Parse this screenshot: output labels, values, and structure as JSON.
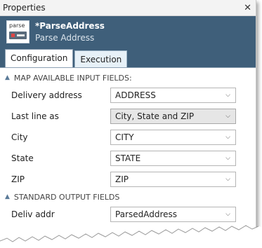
{
  "window": {
    "title": "Properties"
  },
  "header": {
    "icon_label": "parse",
    "title": "*ParseAddress",
    "subtitle": "Parse Address"
  },
  "tabs": [
    {
      "label": "Configuration",
      "active": true
    },
    {
      "label": "Execution",
      "active": false
    }
  ],
  "section_input": {
    "title": "MAP AVAILABLE INPUT FIELDS:",
    "rows": [
      {
        "label": "Delivery address",
        "value": "ADDRESS"
      },
      {
        "label": "Last line as",
        "value": "City, State and ZIP"
      },
      {
        "label": "City",
        "value": "CITY"
      },
      {
        "label": "State",
        "value": "STATE"
      },
      {
        "label": "ZIP",
        "value": "ZIP"
      }
    ]
  },
  "section_output": {
    "title": "STANDARD OUTPUT FIELDS",
    "rows": [
      {
        "label": "Deliv addr",
        "value": "ParsedAddress"
      }
    ]
  },
  "icons": {
    "close": "close-icon",
    "collapse": "caret-up-icon",
    "dropdown": "chevron-down-icon"
  }
}
